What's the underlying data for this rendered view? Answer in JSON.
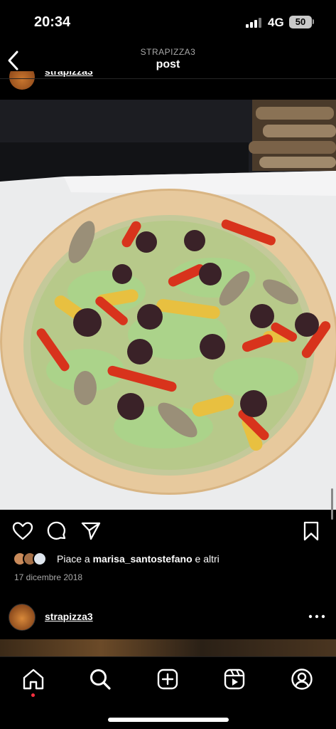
{
  "status": {
    "time": "20:34",
    "network": "4G",
    "battery": "50"
  },
  "header": {
    "account": "STRAPIZZA3",
    "title": "post"
  },
  "post": {
    "author": "strapizza3",
    "likes_prefix": "Piace a",
    "likes_user": "marisa_santostefano",
    "likes_suffix": "e altri",
    "date": "17 dicembre 2018"
  },
  "next_post": {
    "author": "strapizza3"
  },
  "icons": {
    "back": "chevron-left-icon",
    "like": "heart-icon",
    "comment": "comment-bubble-icon",
    "share": "paper-plane-icon",
    "save": "bookmark-icon",
    "more": "more-dots-icon",
    "tabs": [
      "home-icon",
      "search-icon",
      "create-icon",
      "reels-icon",
      "profile-icon"
    ]
  },
  "colors": {
    "background": "#000000",
    "notification_dot": "#ff3040",
    "secondary_text": "#a8a8a8"
  }
}
